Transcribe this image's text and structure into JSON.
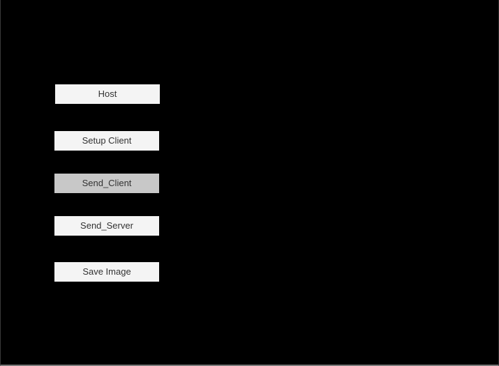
{
  "buttons": {
    "host": "Host",
    "setup_client": "Setup Client",
    "send_client": "Send_Client",
    "send_server": "Send_Server",
    "save_image": "Save Image"
  },
  "colors": {
    "background": "#000000",
    "button": "#f4f4f4",
    "button_pressed": "#c8c8c8",
    "button_text": "#323232"
  }
}
